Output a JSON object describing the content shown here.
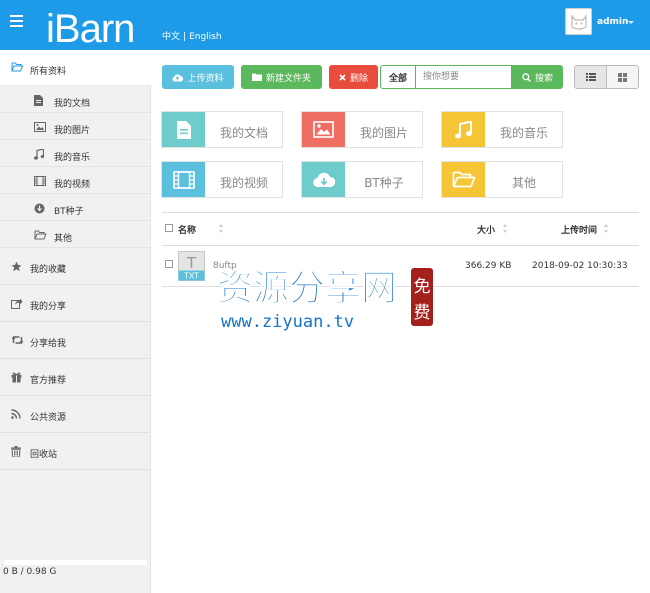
{
  "header": {
    "logo_text": "iBarn",
    "lang_zh": "中文",
    "lang_sep": "|",
    "lang_en": "English",
    "user_name": "admin",
    "bg_color": "#1e9be8"
  },
  "sidebar": {
    "all_files_label": "所有资料",
    "sub_items": [
      {
        "label": "我的文档",
        "icon": "document-icon"
      },
      {
        "label": "我的图片",
        "icon": "image-icon"
      },
      {
        "label": "我的音乐",
        "icon": "music-icon"
      },
      {
        "label": "我的视频",
        "icon": "video-icon"
      },
      {
        "label": "BT种子",
        "icon": "download-icon"
      },
      {
        "label": "其他",
        "icon": "folder-open-icon"
      }
    ],
    "sections": [
      {
        "label": "我的收藏",
        "icon": "star-icon"
      },
      {
        "label": "我的分享",
        "icon": "share-icon"
      },
      {
        "label": "分享给我",
        "icon": "retweet-icon"
      },
      {
        "label": "官方推荐",
        "icon": "gift-icon"
      },
      {
        "label": "公共资源",
        "icon": "rss-icon"
      },
      {
        "label": "回收站",
        "icon": "trash-icon"
      }
    ],
    "storage_text": "0 B / 0.98 G",
    "storage_used_fraction": 0
  },
  "toolbar": {
    "upload_label": "上传资料",
    "new_folder_label": "新建文件夹",
    "delete_label": "删除",
    "scope_label": "全部",
    "search_placeholder": "搜你想要",
    "search_label": "搜索",
    "colors": {
      "upload": "#5bc0de",
      "new_folder": "#5cb85c",
      "delete": "#e74c3c",
      "search": "#5cb85c"
    }
  },
  "categories": [
    {
      "label": "我的文档",
      "color": "#6ecdcc",
      "icon": "document-icon"
    },
    {
      "label": "我的图片",
      "color": "#ee6e63",
      "icon": "image-icon"
    },
    {
      "label": "我的音乐",
      "color": "#f5c535",
      "icon": "music-icon"
    },
    {
      "label": "我的视频",
      "color": "#5bc0de",
      "icon": "film-icon"
    },
    {
      "label": "BT种子",
      "color": "#6ecdcc",
      "icon": "cloud-download-icon"
    },
    {
      "label": "其他",
      "color": "#f5c535",
      "icon": "folder-open-icon"
    }
  ],
  "file_table": {
    "columns": {
      "name": "名称",
      "size": "大小",
      "date": "上传时间"
    },
    "rows": [
      {
        "name": "8uftp",
        "type_badge": "TXT",
        "type_letter": "T",
        "size": "366.29 KB",
        "date": "2018-09-02 10:30:33"
      }
    ]
  },
  "watermark": {
    "title": "资源分享网",
    "url": "www.ziyuan.tv",
    "stamp_1": "免",
    "stamp_2": "费"
  }
}
